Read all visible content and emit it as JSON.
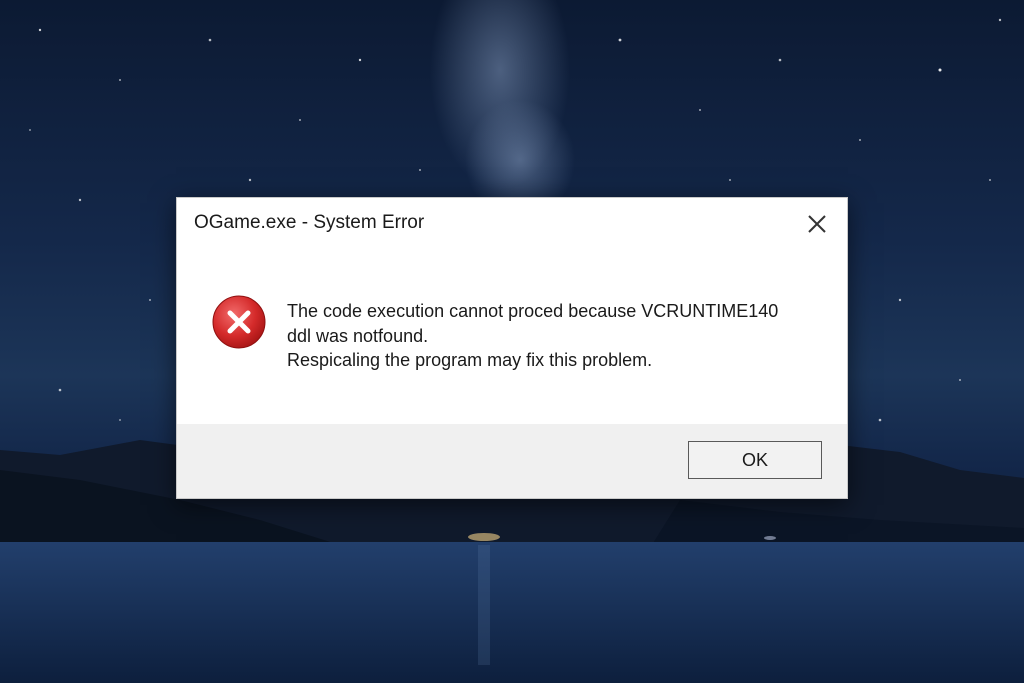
{
  "dialog": {
    "title": "OGame.exe - System Error",
    "message_lines": [
      "The code execution cannot proced because VCRUNTIME140",
      "ddl was notfound.",
      "Respicaling the program may fix this problem."
    ],
    "ok_label": "OK",
    "icon": "error-icon",
    "close_icon": "close-icon"
  },
  "background": {
    "description_icon": "night-lake-wallpaper",
    "sky_color": "#14284a",
    "water_color": "#1b3a66"
  },
  "colors": {
    "dialog_bg": "#ffffff",
    "footer_bg": "#f0f0f0",
    "error_red": "#d42a2a",
    "button_border": "#5a5a5a"
  }
}
